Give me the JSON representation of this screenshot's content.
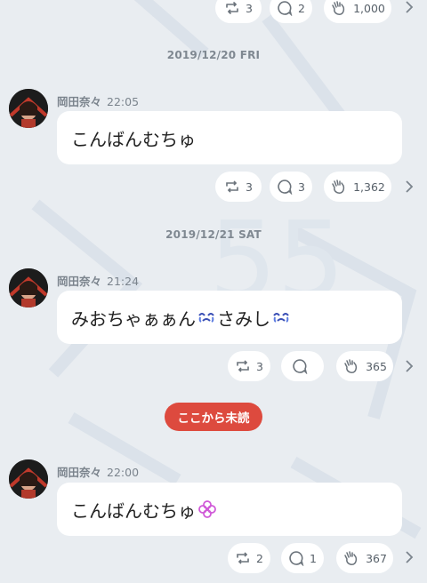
{
  "colors": {
    "background": "#e9edf1",
    "unread_badge": "#dd4a3e",
    "bubble": "#ffffff"
  },
  "top_bar": {
    "repost_count": "3",
    "comment_count": "2",
    "clap_count": "1,000"
  },
  "unread_marker": "ここから未読",
  "messages": [
    {
      "date": "2019/12/20 FRI",
      "author": "岡田奈々",
      "time": "22:05",
      "text": "こんばんむちゅ",
      "repost_count": "3",
      "comment_count": "3",
      "clap_count": "1,362"
    },
    {
      "date": "2019/12/21 SAT",
      "author": "岡田奈々",
      "time": "21:24",
      "text_part1": "みおちゃぁぁん",
      "text_part2": "さみし",
      "emoji": "crying-face-icon",
      "repost_count": "3",
      "comment_count": "",
      "clap_count": "365"
    },
    {
      "author": "岡田奈々",
      "time": "22:00",
      "text": "こんばんむちゅ",
      "emoji": "pink-flower-icon",
      "repost_count": "2",
      "comment_count": "1",
      "clap_count": "367"
    }
  ]
}
